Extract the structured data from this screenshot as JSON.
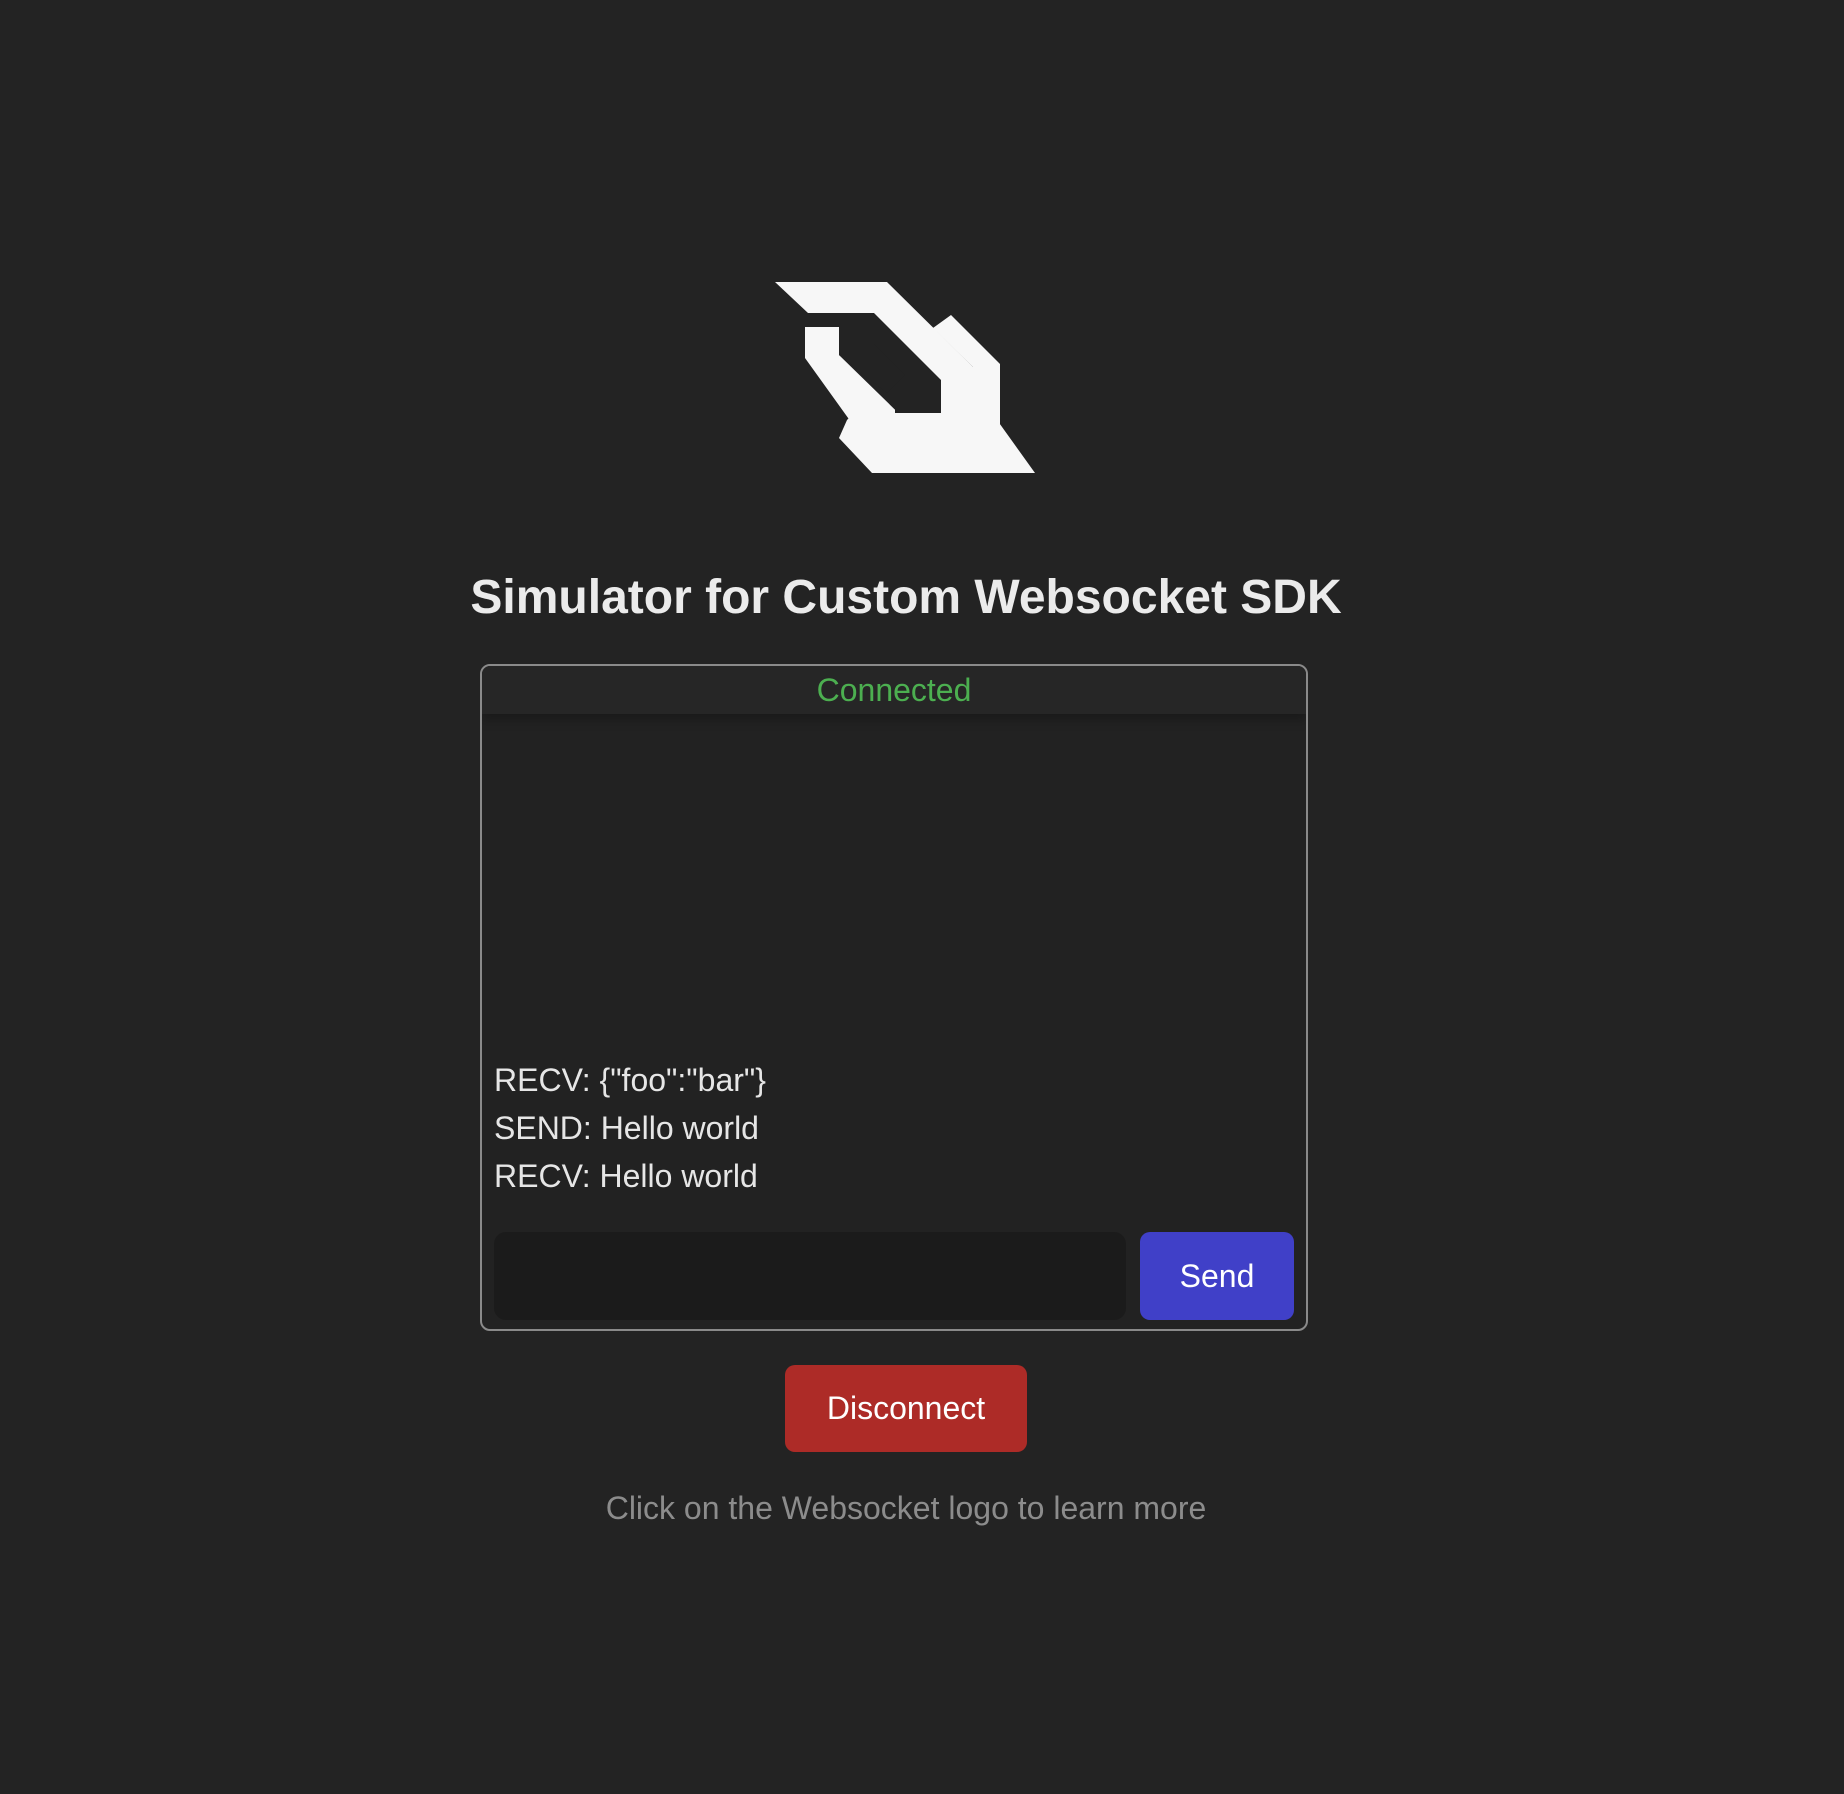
{
  "header": {
    "logo_icon": "websocket-logo-icon",
    "title": "Simulator for Custom Websocket SDK"
  },
  "console": {
    "status": "Connected",
    "status_color": "#4caf50",
    "log": [
      "RECV: {\"foo\":\"bar\"}",
      "SEND: Hello world",
      "RECV: Hello world"
    ],
    "input": {
      "value": "",
      "placeholder": ""
    },
    "send_label": "Send",
    "send_color": "#4040c8"
  },
  "actions": {
    "disconnect_label": "Disconnect",
    "disconnect_color": "#ad2b27"
  },
  "footer": {
    "hint": "Click on the Websocket logo to learn more"
  }
}
